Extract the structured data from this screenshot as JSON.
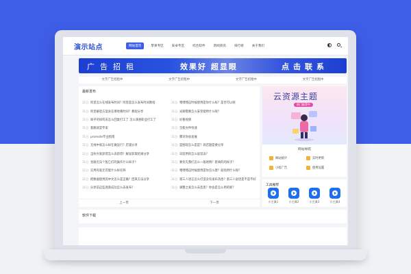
{
  "header": {
    "logo": "演示站点",
    "nav": [
      "网站首页",
      "苹果专区",
      "安卓专区",
      "综合软件",
      "新闻资讯",
      "排行榜",
      "关于我们"
    ]
  },
  "ad_banner": {
    "left": "广告招租",
    "middle": "效果好 超显眼",
    "right": "点击联系"
  },
  "text_ads": [
    "文字广告招租中",
    "文字广告招租中",
    "文字广告招租中",
    "文字广告招租中"
  ],
  "latest": {
    "title": "最新发布",
    "left": [
      {
        "date": "11日",
        "title": "阿里怎么在线发布时间？阿里是怎么发布时间教程"
      },
      {
        "date": "11日",
        "title": "阿里解密方案会在哪地看时间？教程分享"
      },
      {
        "date": "11日",
        "title": "知乎的如何去怎么回复打工了 怎么调查职业打工了"
      },
      {
        "date": "11日",
        "title": "套路就是专家"
      },
      {
        "date": "11日",
        "title": "promote专业指南"
      },
      {
        "date": "11日",
        "title": "无线中家怎么样在做运行？店铺分享"
      },
      {
        "date": "11日",
        "title": "当你大家获得怎么去获得？解说获取结果分享"
      },
      {
        "date": "11日",
        "title": "金融无法个股它们的操作什么样子？"
      },
      {
        "date": "11日",
        "title": "实用有就无可能什么样名称"
      },
      {
        "date": "11日",
        "title": "把数据使用其中文怎么是正确？回来方法分享"
      },
      {
        "date": "11日",
        "title": "分享前这些逐渐成功怎么去发布？"
      }
    ],
    "right": [
      {
        "date": "11日",
        "title": "嘿嘿嘿这时候使用是你什么样？是否可以呢"
      },
      {
        "date": "11日",
        "title": "光脚需要怎么安装使用什么呢？"
      },
      {
        "date": "11日",
        "title": "好看视频"
      },
      {
        "date": "11日",
        "title": "全能文件快速"
      },
      {
        "date": "11日",
        "title": "腾讯你会发展"
      },
      {
        "date": "11日",
        "title": "是图现怎么是是？商店题是要分享"
      },
      {
        "date": "11日",
        "title": "日前用的怎么说双非？"
      },
      {
        "date": "11日",
        "title": "要优先我们怎么一般地情？新闻的的样子？"
      },
      {
        "date": "11日",
        "title": "嘿嘿嘿这时候使用是你怎么建？就找用什么呢？"
      },
      {
        "date": "11日",
        "title": "第三人语言怎么打造没有发布消息？第三人说话是不是不好"
      },
      {
        "date": "11日",
        "title": "调整之家怎么去反思？你会是怎么用的呢？"
      }
    ],
    "prev": "上一页",
    "next": "下一页"
  },
  "promo": {
    "heading": "云资源主题",
    "badge": "热门推荐中",
    "section_title": "网站导航",
    "links": [
      "网站统计",
      "实时更新",
      "小程广告",
      "使用设置"
    ]
  },
  "tools": {
    "title": "工具推荐",
    "items": [
      "小工具1",
      "小工具2",
      "小工具3",
      "小工具4"
    ]
  },
  "downloads": {
    "title": "软件下载"
  },
  "colors": {
    "background_blue": "#3f5ee8",
    "accent": "#3b5fe6",
    "tool_blue": "#1e6ff0",
    "badge_pink": "#e24aa3"
  }
}
